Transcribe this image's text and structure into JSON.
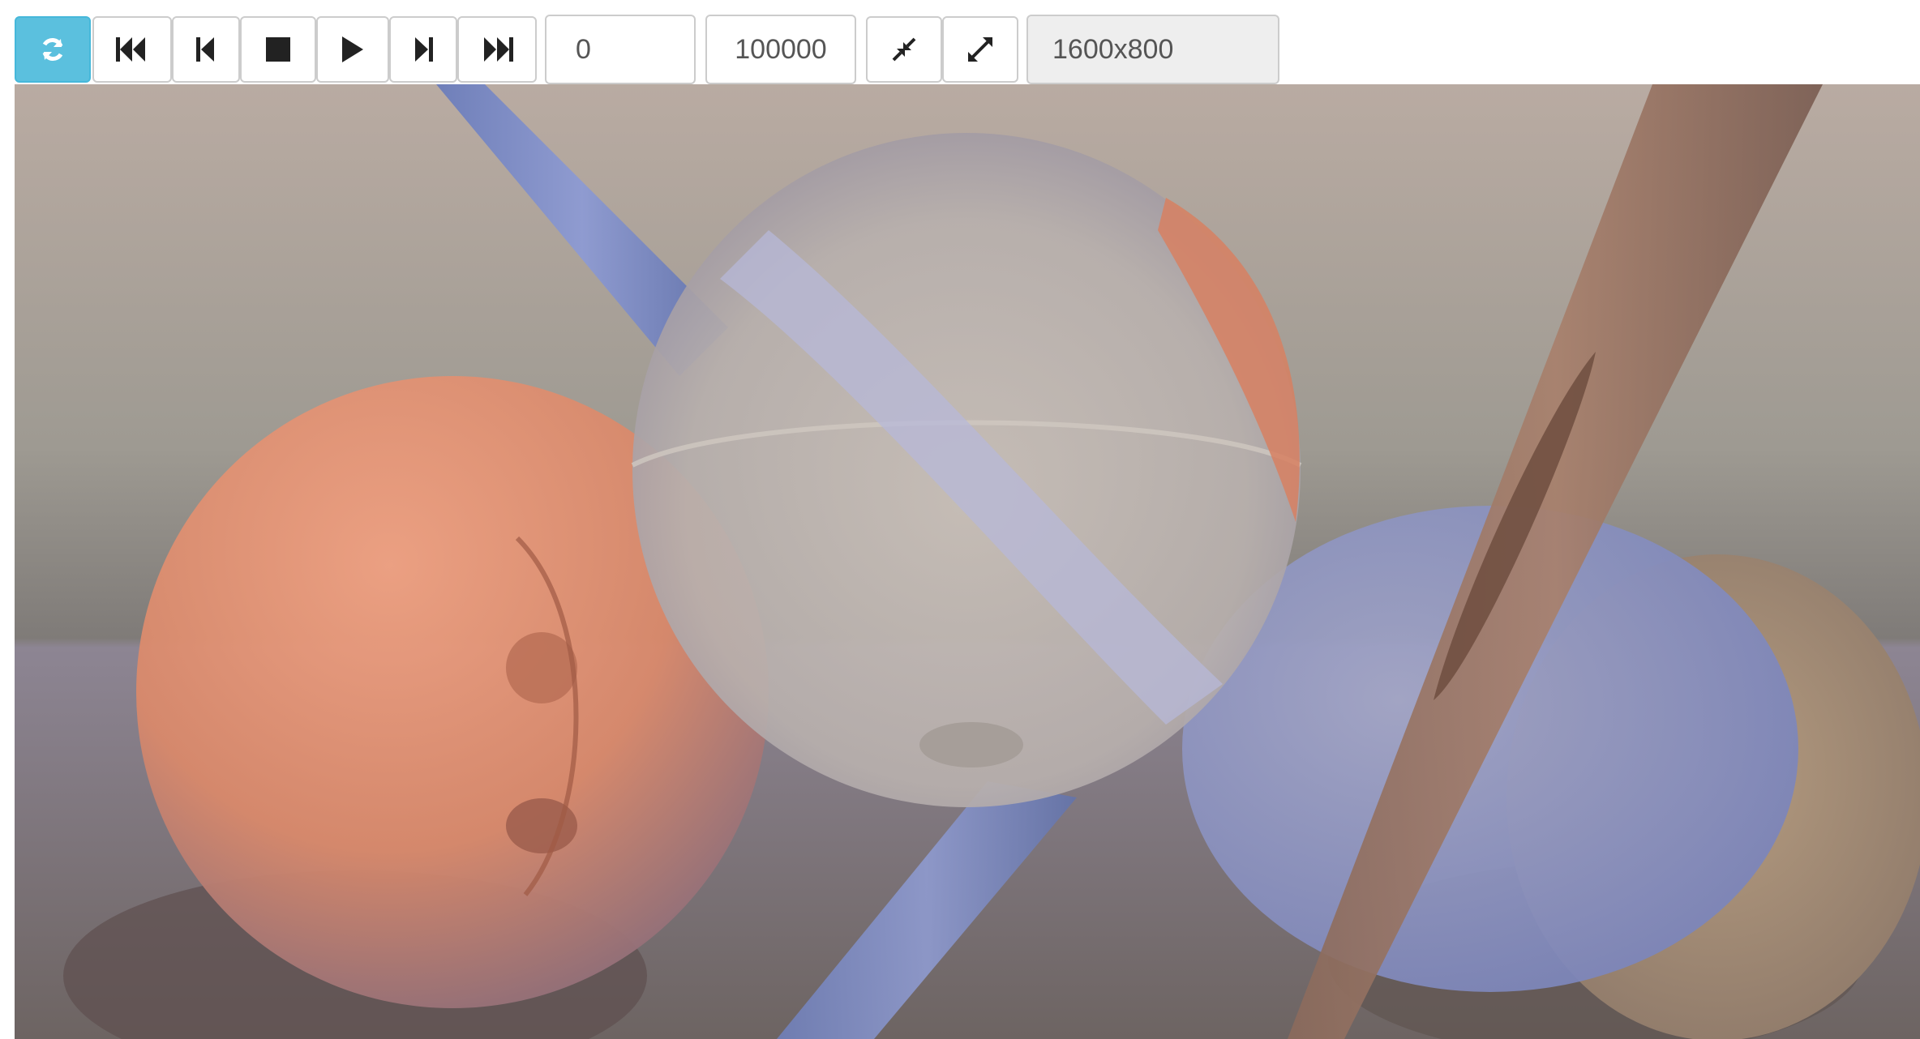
{
  "toolbar": {
    "refresh": {
      "icon": "refresh-icon"
    },
    "first": {
      "icon": "fast-backward-icon"
    },
    "prev": {
      "icon": "step-backward-icon"
    },
    "stop": {
      "icon": "stop-icon"
    },
    "play": {
      "icon": "play-icon"
    },
    "next": {
      "icon": "step-forward-icon"
    },
    "last": {
      "icon": "fast-forward-icon"
    },
    "start_value": "0",
    "end_value": "100000",
    "shrink": {
      "icon": "compress-icon"
    },
    "expand": {
      "icon": "expand-icon"
    },
    "resolution": "1600x800"
  },
  "colors": {
    "accent": "#5bc0de",
    "border": "#cccccc",
    "readonly_bg": "#eeeeee",
    "icon": "#222222"
  },
  "render": {
    "description_icon": "raytraced-scene"
  }
}
